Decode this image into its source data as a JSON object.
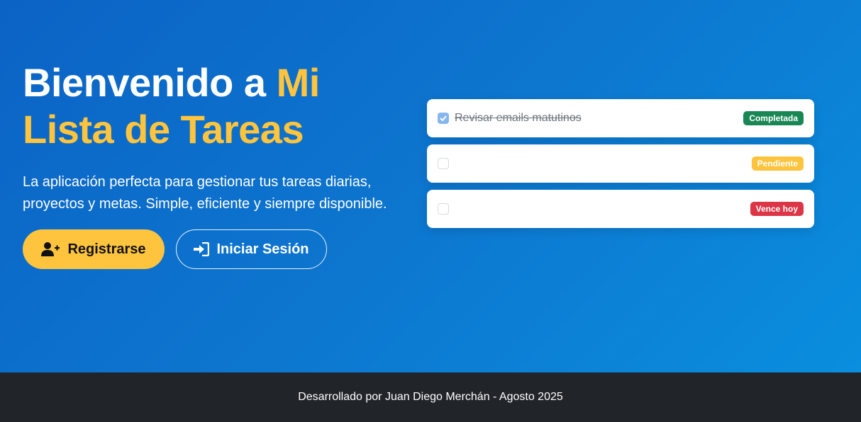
{
  "hero": {
    "title_main": "Bienvenido a ",
    "title_accent": "Mi Lista de Tareas",
    "subtitle": "La aplicación perfecta para gestionar tus tareas diarias, proyectos y metas. Simple, eficiente y siempre disponible.",
    "register_label": "Registrarse",
    "login_label": "Iniciar Sesión",
    "register_icon": "user-plus-icon",
    "login_icon": "sign-in-icon"
  },
  "tasks": [
    {
      "text": "Revisar emails matutinos",
      "checked": true,
      "badge": "Completada",
      "badge_color": "#198754"
    },
    {
      "text": "",
      "checked": false,
      "badge": "Pendiente",
      "badge_color": "#ffc43d"
    },
    {
      "text": "",
      "checked": false,
      "badge": "Vence hoy",
      "badge_color": "#dc3545"
    }
  ],
  "footer": {
    "text": "Desarrollado por Juan Diego Merchán - Agosto 2025"
  },
  "colors": {
    "accent": "#ffc43d",
    "hero_gradient_start": "#0b63c5",
    "hero_gradient_end": "#0a8ede",
    "footer_bg": "#212529"
  }
}
